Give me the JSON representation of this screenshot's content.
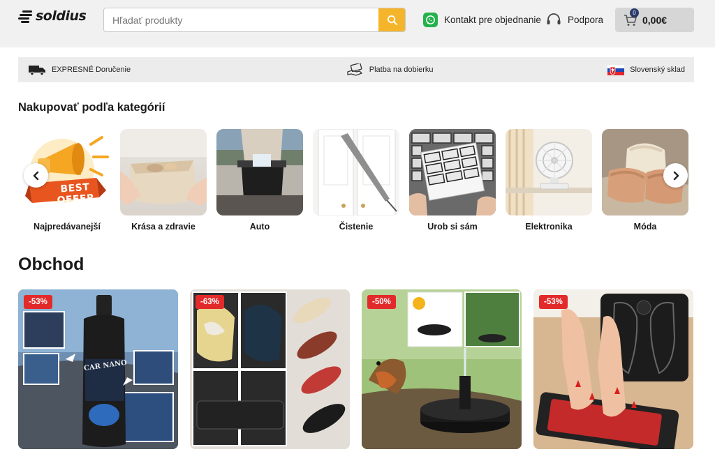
{
  "header": {
    "logo_text": "soldius",
    "search": {
      "placeholder": "Hľadať produkty",
      "value": ""
    },
    "contact_label": "Kontakt pre objednanie",
    "support_label": "Podpora",
    "cart": {
      "count": "0",
      "total": "0,00€"
    }
  },
  "infobar": {
    "delivery": "EXPRESNÉ Doručenie",
    "payment": "Platba na dobierku",
    "warehouse": "Slovenský sklad"
  },
  "categories": {
    "title": "Nakupovať podľa kategórií",
    "items": [
      {
        "label": "Najpredávanejší",
        "image_text": "BEST OFFER"
      },
      {
        "label": "Krása a zdravie"
      },
      {
        "label": "Auto"
      },
      {
        "label": "Čistenie"
      },
      {
        "label": "Urob si sám"
      },
      {
        "label": "Elektronika"
      },
      {
        "label": "Móda"
      }
    ]
  },
  "shop": {
    "title": "Obchod",
    "products": [
      {
        "discount": "-53%",
        "image_text": "CAR NANO"
      },
      {
        "discount": "-63%"
      },
      {
        "discount": "-50%"
      },
      {
        "discount": "-53%"
      }
    ]
  },
  "colors": {
    "accent": "#f5b52a",
    "discount": "#e32a2a",
    "whatsapp": "#25b14c"
  }
}
